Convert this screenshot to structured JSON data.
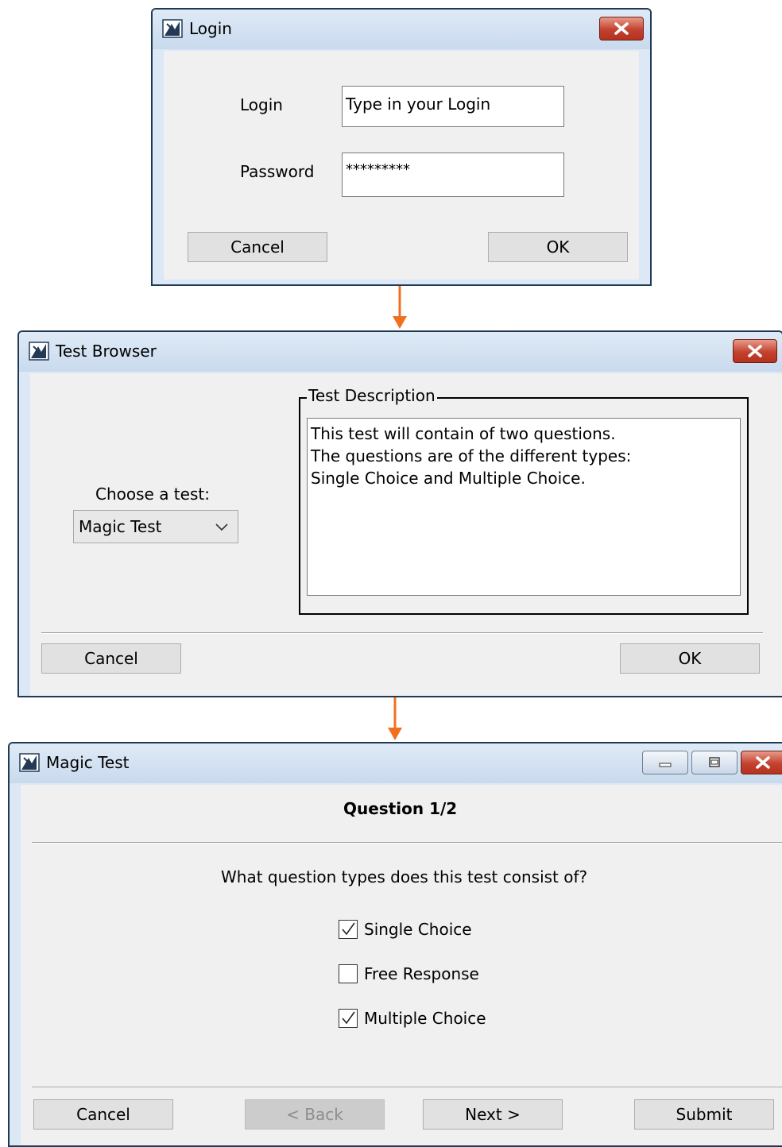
{
  "login_dialog": {
    "title": "Login",
    "login_label": "Login",
    "login_value": "Type in your Login",
    "password_label": "Password",
    "password_value": "*********",
    "cancel_label": "Cancel",
    "ok_label": "OK"
  },
  "test_browser": {
    "title": "Test Browser",
    "choose_label": "Choose a test:",
    "selected_test": "Magic Test",
    "description_legend": "Test Description",
    "description_lines": [
      "This test will contain of two questions.",
      "The questions are of the different types:",
      "Single Choice and Multiple Choice."
    ],
    "cancel_label": "Cancel",
    "ok_label": "OK"
  },
  "magic_test": {
    "title": "Magic Test",
    "question_header": "Question 1/2",
    "question_text": "What question types does this test consist of?",
    "options": [
      {
        "label": "Single Choice",
        "checked": true
      },
      {
        "label": "Free Response",
        "checked": false
      },
      {
        "label": "Multiple Choice",
        "checked": true
      }
    ],
    "cancel_label": "Cancel",
    "back_label": "< Back",
    "next_label": "Next >",
    "submit_label": "Submit"
  },
  "colors": {
    "arrow": "#f07020",
    "close_button": "#c4412f",
    "window_frame": "#dce8f5",
    "content_bg": "#f0f0f0"
  },
  "icons": [
    "app-logo-icon",
    "close-icon",
    "minimize-icon",
    "maximize-icon",
    "chevron-down-icon",
    "checkmark-icon",
    "flow-arrow-icon"
  ]
}
